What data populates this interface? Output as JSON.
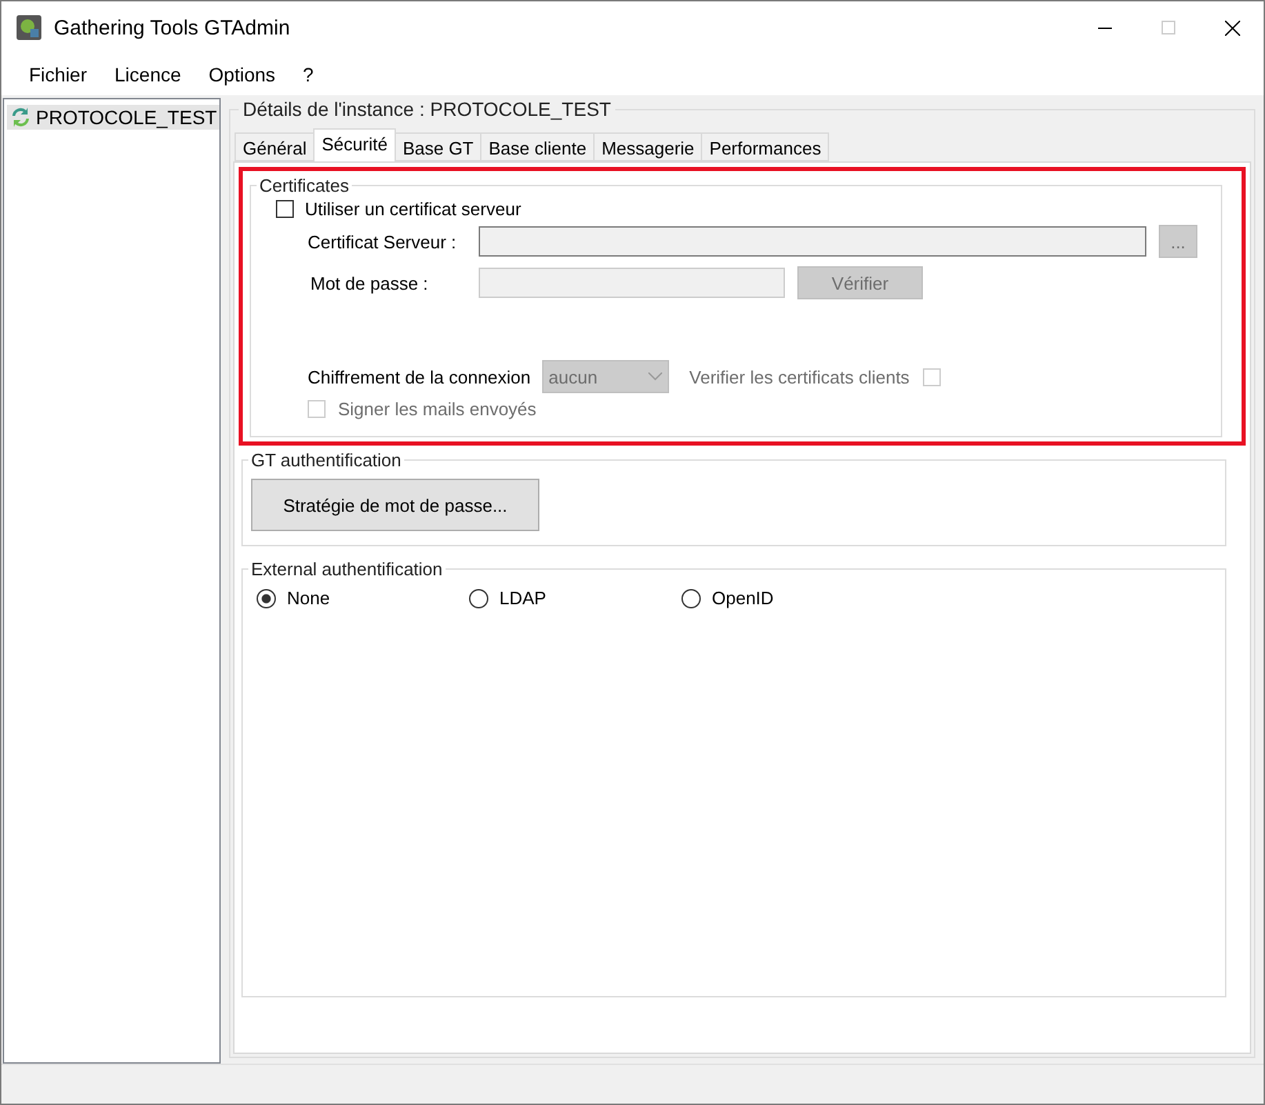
{
  "window": {
    "title": "Gathering Tools GTAdmin"
  },
  "menu": [
    "Fichier",
    "Licence",
    "Options",
    "?"
  ],
  "tree": [
    {
      "label": "PROTOCOLE_TEST",
      "selected": true
    }
  ],
  "instance_group": {
    "title": "Détails de l'instance : PROTOCOLE_TEST"
  },
  "tabs": [
    {
      "label": "Général",
      "selected": false
    },
    {
      "label": "Sécurité",
      "selected": true
    },
    {
      "label": "Base GT",
      "selected": false
    },
    {
      "label": "Base cliente",
      "selected": false
    },
    {
      "label": "Messagerie",
      "selected": false
    },
    {
      "label": "Performances",
      "selected": false
    }
  ],
  "certificates": {
    "title": "Certificates",
    "highlighted": true,
    "use_server_cert": {
      "label": "Utiliser un certificat serveur",
      "checked": false
    },
    "server_cert": {
      "label": "Certificat Serveur :",
      "disabled": true
    },
    "browse_button": {
      "label": "...",
      "disabled": true
    },
    "password": {
      "label": "Mot de passe :",
      "disabled": true
    },
    "verify_button": {
      "label": "Vérifier",
      "disabled": true
    },
    "encryption": {
      "label": "Chiffrement de la connexion",
      "value": "aucun",
      "disabled": true
    },
    "verify_clients": {
      "label": "Verifier les certificats clients",
      "checked": false,
      "disabled": true
    },
    "sign_mails": {
      "label": "Signer les mails envoyés",
      "checked": false,
      "disabled": true
    }
  },
  "gt_auth": {
    "title": "GT authentification",
    "button": "Stratégie de mot de passe..."
  },
  "external_auth": {
    "title": "External authentification",
    "options": [
      {
        "label": "None",
        "selected": true
      },
      {
        "label": "LDAP",
        "selected": false
      },
      {
        "label": "OpenID",
        "selected": false
      }
    ]
  }
}
